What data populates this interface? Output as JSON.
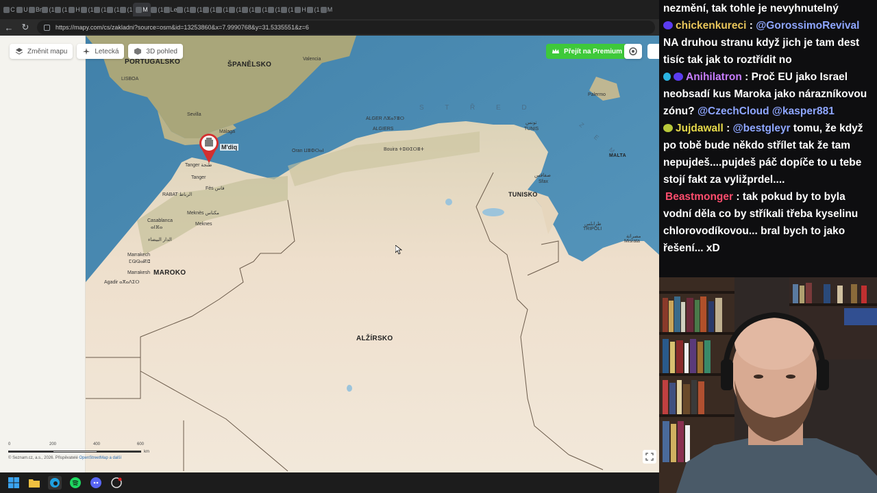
{
  "browser": {
    "url": "https://mapy.com/cs/zakladni?source=osm&id=13253860&x=7.9990768&y=31.5335551&z=6",
    "active_tab_label": "M",
    "tabs": [
      "C",
      "U",
      "Br",
      "(1",
      "(1",
      "H",
      "(1",
      "(1",
      "(1",
      "(1",
      "M",
      "(1",
      "Le",
      "(1",
      "(1",
      "(1",
      "(1",
      "(1",
      "(1",
      "(1",
      "(1",
      "(1",
      "H",
      "(1",
      "M"
    ]
  },
  "map_toolbar": {
    "change_map": "Změnit mapu",
    "aerial": "Letecká",
    "view_3d": "3D pohled",
    "premium": "Přejít na Premium"
  },
  "map_labels": {
    "countries": {
      "portugal": "PORTUGALSKO",
      "spain": "ŠPANĚLSKO",
      "morocco": "MAROKO",
      "algeria": "ALŽÍRSKO",
      "tunisia": "TUNISKO",
      "malta": "MALTA"
    },
    "sea": "S T Ř E D",
    "sea2": "Z E M",
    "cities": {
      "lisboa": "LISBOA",
      "valencia": "Valencia",
      "sevilla": "Sevilla",
      "malaga": "Málaga",
      "mdiq": "M'diq",
      "tanger": "Tanger",
      "tanger_ar": "Tanger طنجة",
      "fes": "Fès فاس",
      "rabat": "RABAT الرباط",
      "meknes": "Meknès مكناس",
      "meknes2": "Meknes",
      "casablanca": "Casablanca",
      "casablanca_ar": "ⴰⵏⴼⴰ",
      "casablanca_ar2": "الدار البيضاء",
      "marrakech": "Marrakech",
      "marrakech_ar": "ⵎⵕⵕⴰⴽⵛ",
      "marrakech2": "Marrakesh",
      "agadir": "Agadir ⴰⴳⴰⴷⵉⵔ",
      "alger": "ALGER ⴷⵣⴰⵢⴻⵔ",
      "algiers": "ALGIERS",
      "oran": "Oran ⵡⴻⵀⵔⴰⵏ",
      "bouira": "Bouira ⵜⵓⴱⵉⵔⴻⵜ",
      "tunis": "TUNIS",
      "tunis_ar": "تونس",
      "sfax": "صفاقس",
      "sfax2": "Sfax",
      "tripoli": "TRIPOLI",
      "tripoli_ar": "طرابلس",
      "misrata": "مصراتة",
      "misrata2": "Misrata",
      "palermo": "Palermo"
    }
  },
  "scale": {
    "ticks": [
      "0",
      "200",
      "400",
      "600"
    ],
    "unit": "km"
  },
  "copyright": {
    "text": "© Seznam.cz, a.s., 2026. Přispěvatelé",
    "osm": "OpenStreetMap a další"
  },
  "chat": {
    "messages": [
      {
        "user": "",
        "user_color": "#ffffff",
        "text": "nezmění, tak tohle je nevyhnutelný",
        "mentions": ""
      },
      {
        "user": "chickenkureci",
        "user_color": "#e8c55a",
        "mentions": "@GorossimoRevival",
        "text": "NA druhou stranu když jich je tam dest tisíc tak jak to roztřídit no"
      },
      {
        "user": "Anihilatron",
        "user_color": "#c77dff",
        "mentions": "",
        "text": "Proč EU jako Israel neobsadí kus Maroka jako nárazníkovou zónu?",
        "mentions_after": "@CzechCloud @kasper881"
      },
      {
        "user": "Jujdawall",
        "user_color": "#e6d94a",
        "mentions": "@bestgleyr",
        "text": "tomu, že když po tobě bude někdo střílet tak že tam nepujdeš....pujdeš páč dopíče to u tebe stojí fakt za vyližprdel...."
      },
      {
        "user": "Beastmonger",
        "user_color": "#ff4d6d",
        "mentions": "",
        "text": "tak pokud by to byla vodní děla co by stříkali třeba kyselinu chlorovodíkovou... bral bych to jako řešení... xD"
      }
    ],
    "separator": " : "
  },
  "colors": {
    "sea": "#4f8fb5",
    "land": "#eedfcc",
    "premium": "#3ec93a",
    "marker": "#d42f2f"
  }
}
